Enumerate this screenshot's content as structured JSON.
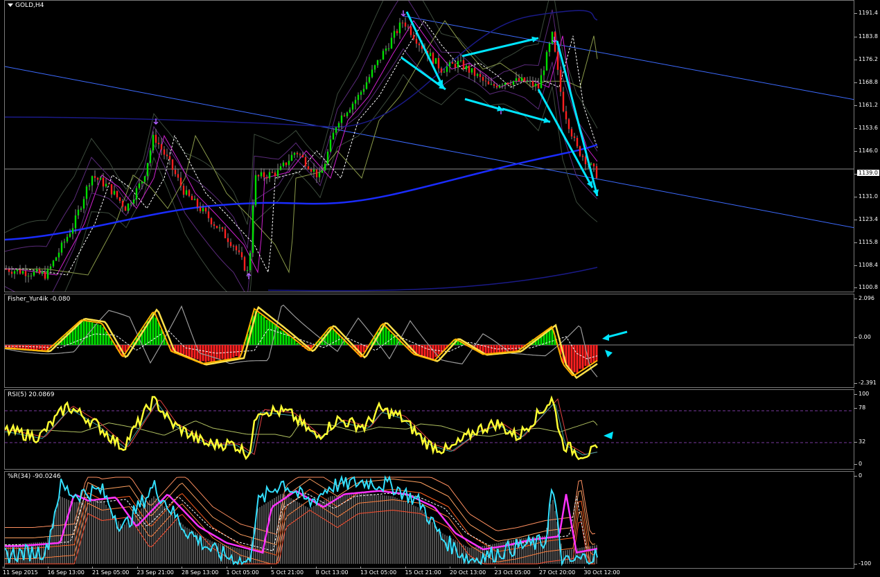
{
  "main_chart": {
    "title": "GOLD,H4",
    "current_price": "1139.0",
    "price_ticks": [
      "1191.4",
      "1183.8",
      "1176.2",
      "1168.8",
      "1161.2",
      "1153.6",
      "1146.0",
      "1139.0",
      "1131.0",
      "1123.4",
      "1115.8",
      "1108.4",
      "1100.8"
    ]
  },
  "fisher": {
    "title": "Fisher_Yur4ik -0.080",
    "ticks": [
      "2.096",
      "0.00",
      "-2.391"
    ]
  },
  "rsi": {
    "title": "RSI(5) 20.0869",
    "ticks": [
      "100",
      "78",
      "32",
      "0"
    ]
  },
  "wpr": {
    "title": "%R(34) -90.0246",
    "ticks": [
      "0",
      "-100"
    ]
  },
  "time_axis": [
    "11 Sep 2015",
    "16 Sep 13:00",
    "21 Sep 05:00",
    "23 Sep 21:00",
    "28 Sep 13:00",
    "1 Oct 05:00",
    "5 Oct 21:00",
    "8 Oct 13:00",
    "13 Oct 05:00",
    "15 Oct 21:00",
    "20 Oct 13:00",
    "23 Oct 05:00",
    "27 Oct 20:00",
    "30 Oct 12:00"
  ],
  "colors": {
    "background": "#000000",
    "bull": "#00e000",
    "bear": "#ff2020",
    "arrow": "#00e5ff",
    "ma_blue": "#1a2cff",
    "channel": "#3d6bff",
    "rsi": "#ffff33",
    "fisher": "#ffb000",
    "wpr_cyan": "#33e0ff",
    "wpr_magenta": "#ff33ff"
  }
}
